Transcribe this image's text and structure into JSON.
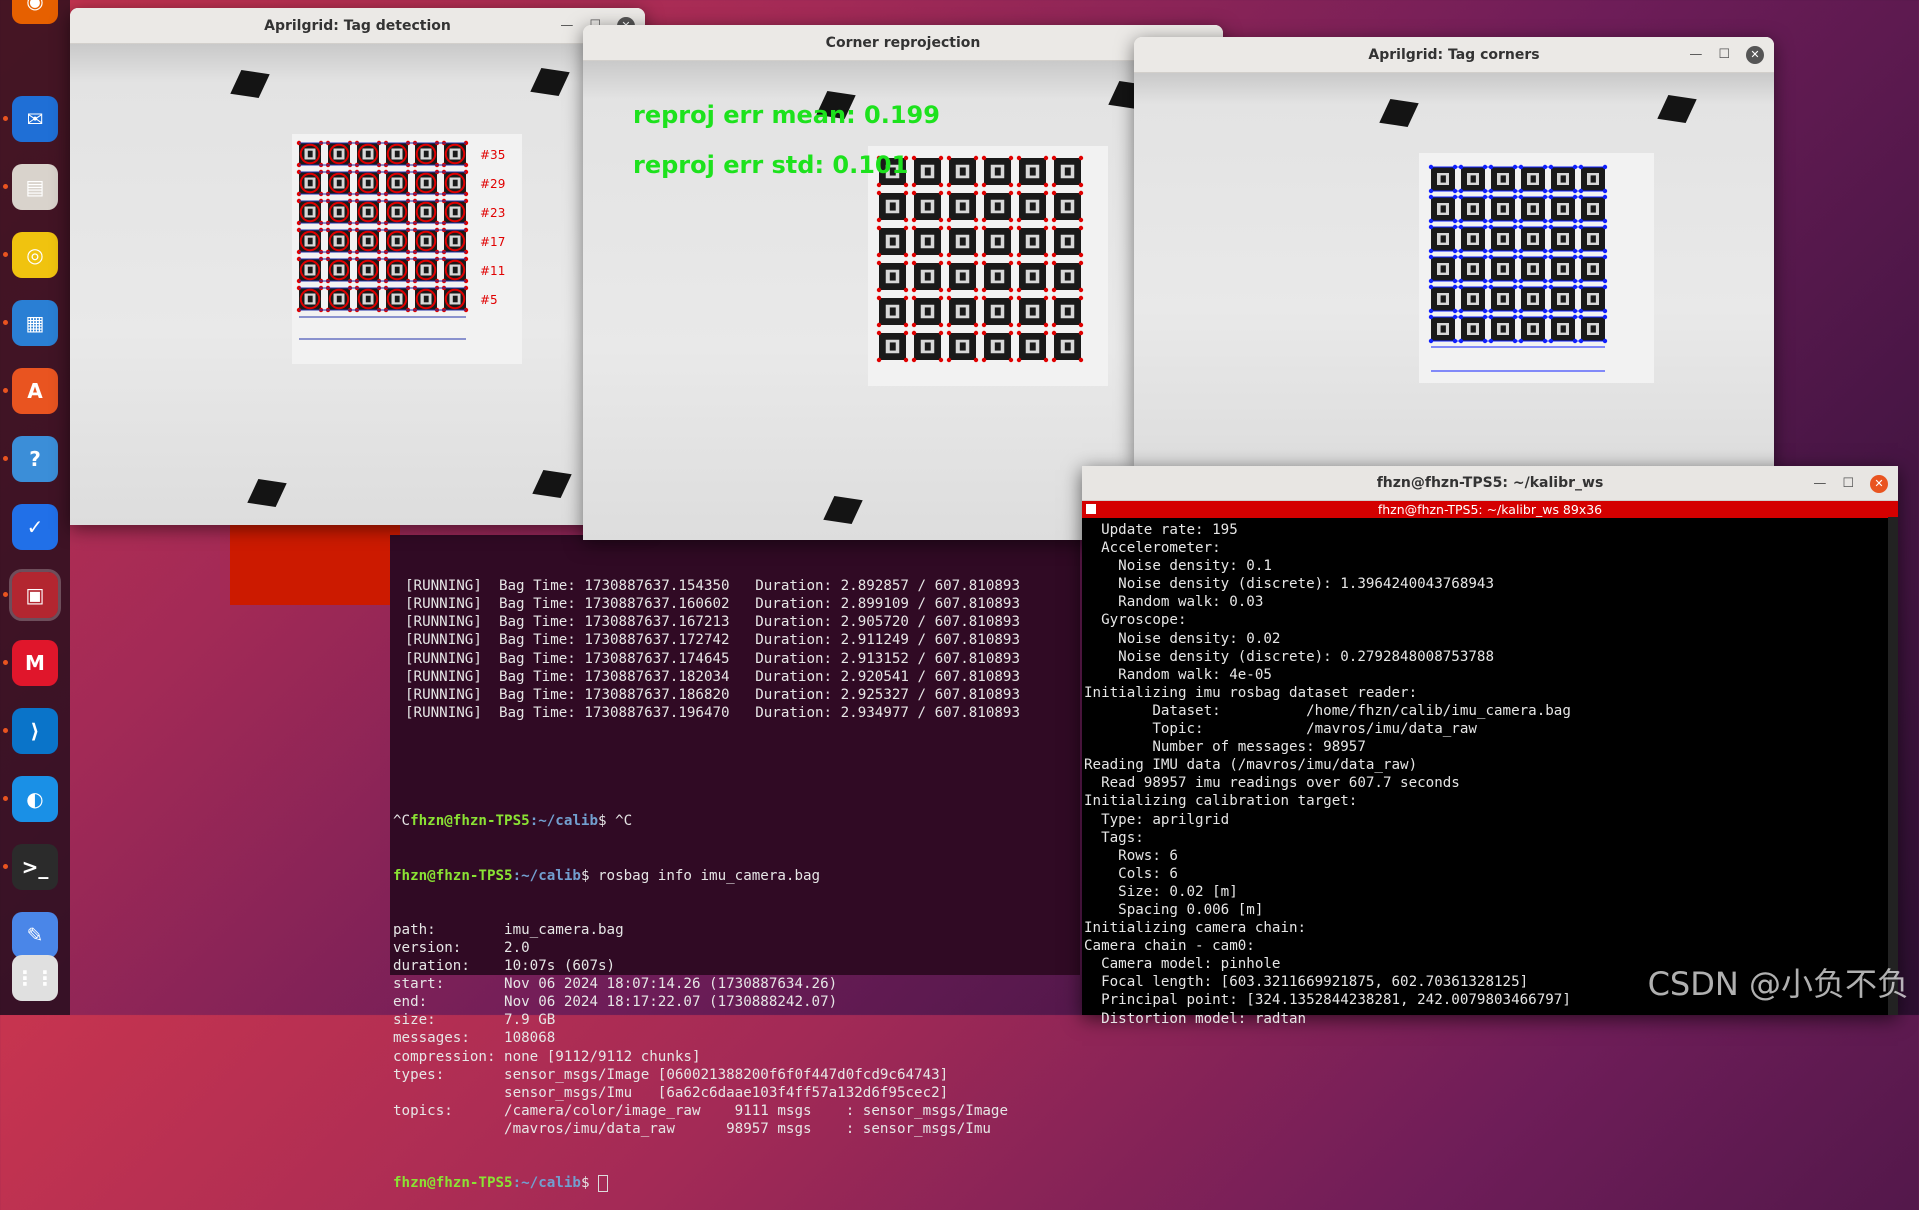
{
  "dock": {
    "icons": [
      "firefox-icon",
      "thunderbird-icon",
      "files-icon",
      "rhythmbox-icon",
      "writer-icon",
      "software-icon",
      "help-icon",
      "feishu-icon",
      "image-viewer-icon",
      "appimage-icon",
      "vscode-icon",
      "browser-icon",
      "terminal-icon",
      "text-editor-icon",
      "show-apps-icon"
    ]
  },
  "window_detection": {
    "title": "Aprilgrid: Tag detection",
    "ids": [
      "#35",
      "#29",
      "#23",
      "#17",
      "#11",
      "#5"
    ]
  },
  "window_reprojection": {
    "title": "Corner reprojection",
    "mean": "reproj err mean: 0.199",
    "std": "reproj err std: 0.101"
  },
  "window_corners": {
    "title": "Aprilgrid: Tag corners"
  },
  "terminal_calib": {
    "running_lines": [
      "[RUNNING]  Bag Time: 1730887637.154350   Duration: 2.892857 / 607.810893",
      "[RUNNING]  Bag Time: 1730887637.160602   Duration: 2.899109 / 607.810893",
      "[RUNNING]  Bag Time: 1730887637.167213   Duration: 2.905720 / 607.810893",
      "[RUNNING]  Bag Time: 1730887637.172742   Duration: 2.911249 / 607.810893",
      "[RUNNING]  Bag Time: 1730887637.174645   Duration: 2.913152 / 607.810893",
      "[RUNNING]  Bag Time: 1730887637.182034   Duration: 2.920541 / 607.810893",
      "[RUNNING]  Bag Time: 1730887637.186820   Duration: 2.925327 / 607.810893",
      "[RUNNING]  Bag Time: 1730887637.196470   Duration: 2.934977 / 607.810893"
    ],
    "ctrl_c": "^C",
    "user": "fhzn@fhzn-TPS5",
    "path": ":~/calib",
    "cmd1": "$ ^C",
    "cmd2": "$ rosbag info imu_camera.bag",
    "info_lines": [
      "path:        imu_camera.bag",
      "version:     2.0",
      "duration:    10:07s (607s)",
      "start:       Nov 06 2024 18:07:14.26 (1730887634.26)",
      "end:         Nov 06 2024 18:17:22.07 (1730888242.07)",
      "size:        7.9 GB",
      "messages:    108068",
      "compression: none [9112/9112 chunks]",
      "types:       sensor_msgs/Image [060021388200f6f0f447d0fcd9c64743]",
      "             sensor_msgs/Imu   [6a62c6daae103f4ff57a132d6f95cec2]",
      "topics:      /camera/color/image_raw    9111 msgs    : sensor_msgs/Image",
      "             /mavros/imu/data_raw      98957 msgs    : sensor_msgs/Imu"
    ],
    "prompt_end": "$ "
  },
  "terminal_kalibr": {
    "title": "fhzn@fhzn-TPS5: ~/kalibr_ws",
    "tab": "fhzn@fhzn-TPS5: ~/kalibr_ws 89x36",
    "lines": [
      "  Update rate: 195",
      "  Accelerometer:",
      "    Noise density: 0.1",
      "    Noise density (discrete): 1.3964240043768943",
      "    Random walk: 0.03",
      "  Gyroscope:",
      "    Noise density: 0.02",
      "    Noise density (discrete): 0.2792848008753788",
      "    Random walk: 4e-05",
      "Initializing imu rosbag dataset reader:",
      "        Dataset:          /home/fhzn/calib/imu_camera.bag",
      "        Topic:            /mavros/imu/data_raw",
      "        Number of messages: 98957",
      "Reading IMU data (/mavros/imu/data_raw)",
      "  Read 98957 imu readings over 607.7 seconds",
      "Initializing calibration target:",
      "  Type: aprilgrid",
      "  Tags:",
      "    Rows: 6",
      "    Cols: 6",
      "    Size: 0.02 [m]",
      "    Spacing 0.006 [m]",
      "Initializing camera chain:",
      "Camera chain - cam0:",
      "  Camera model: pinhole",
      "  Focal length: [603.3211669921875, 602.70361328125]",
      "  Principal point: [324.1352844238281, 242.0079803466797]",
      "  Distortion model: radtan"
    ]
  },
  "watermark": "CSDN @小负不负",
  "colors": {
    "accent": "#e95420",
    "terminal_bg": "#300a24",
    "prompt_user": "#8ae234",
    "prompt_path": "#729fcf",
    "overlay": "#1de21d"
  }
}
